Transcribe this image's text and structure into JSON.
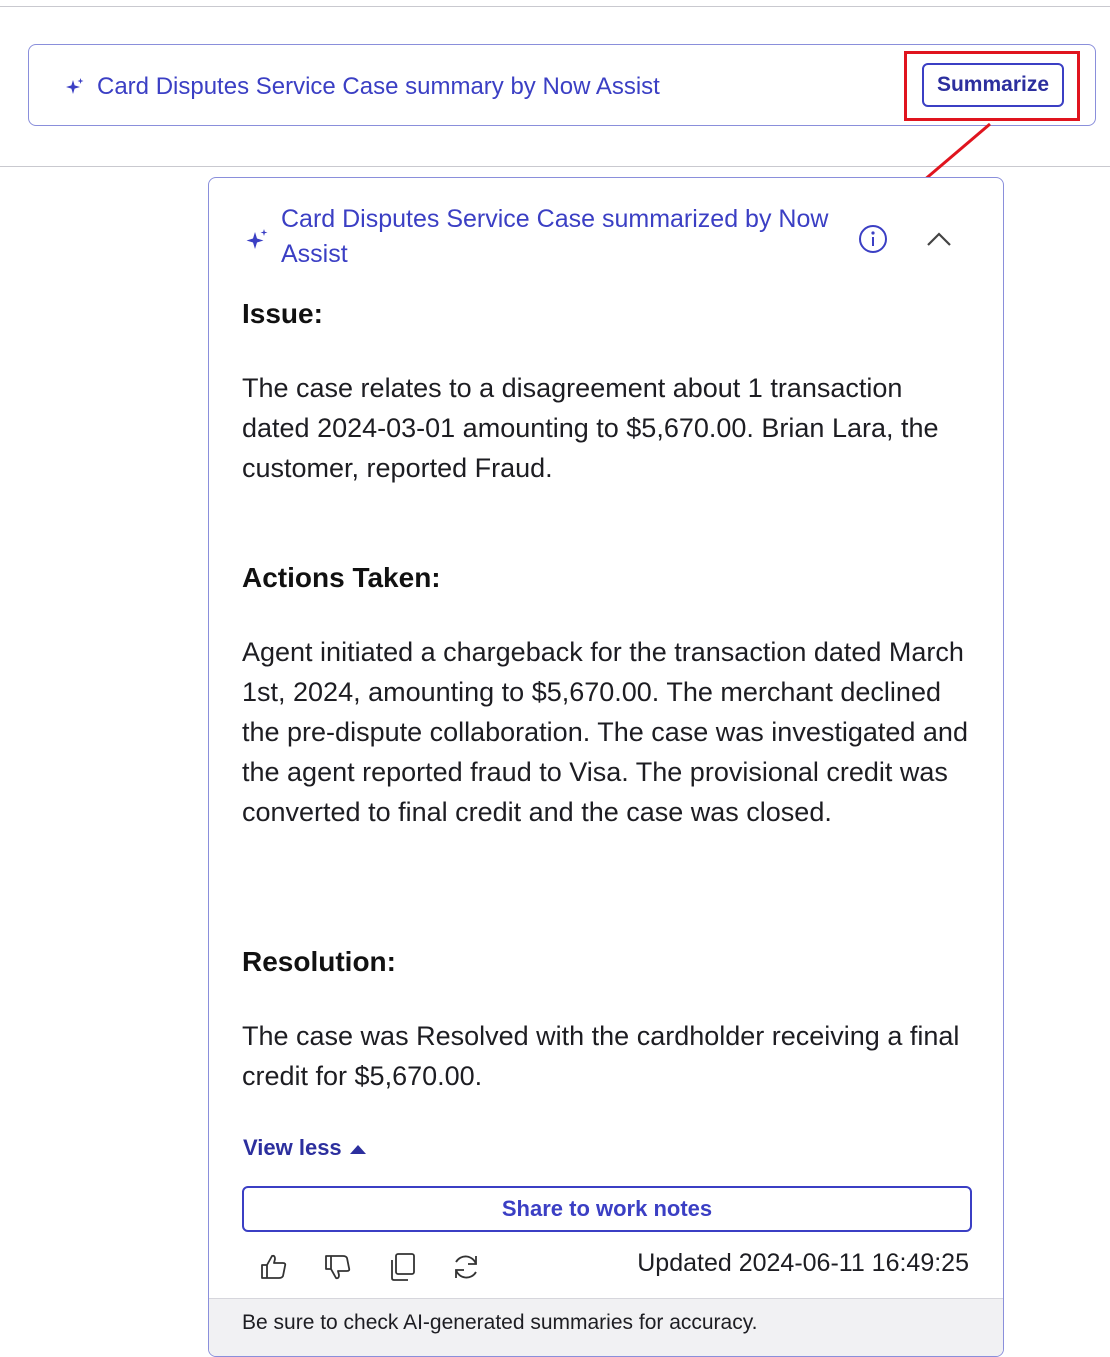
{
  "banner": {
    "title": "Card Disputes Service Case summary by Now Assist",
    "summarize_label": "Summarize"
  },
  "card": {
    "title": "Card Disputes Service Case summarized by Now Assist",
    "sections": [
      {
        "heading": "Issue:",
        "text": "The case relates to a disagreement about 1 transaction dated 2024-03-01 amounting to $5,670.00. Brian Lara, the customer, reported Fraud."
      },
      {
        "heading": "Actions Taken:",
        "text": "Agent initiated a chargeback for the transaction dated March 1st, 2024, amounting to $5,670.00. The merchant declined the pre-dispute collaboration. The case was investigated and the agent reported fraud to Visa. The provisional credit was converted to final credit and the case was closed."
      },
      {
        "heading": "Resolution:",
        "text": "The case was Resolved with the cardholder receiving a final credit for $5,670.00."
      }
    ],
    "view_less_label": "View less",
    "share_label": "Share to work notes",
    "updated_text": "Updated 2024-06-11 16:49:25",
    "disclaimer": "Be sure to check AI-generated summaries for accuracy."
  },
  "icons": {
    "sparkle": "sparkle-icon",
    "info": "info-icon",
    "collapse": "chevron-up-icon",
    "like": "thumbs-up-icon",
    "dislike": "thumbs-down-icon",
    "copy": "copy-icon",
    "regenerate": "refresh-icon"
  },
  "colors": {
    "accent": "#3b3fc4",
    "highlight": "#e0141e",
    "border": "#8a8fdb"
  }
}
